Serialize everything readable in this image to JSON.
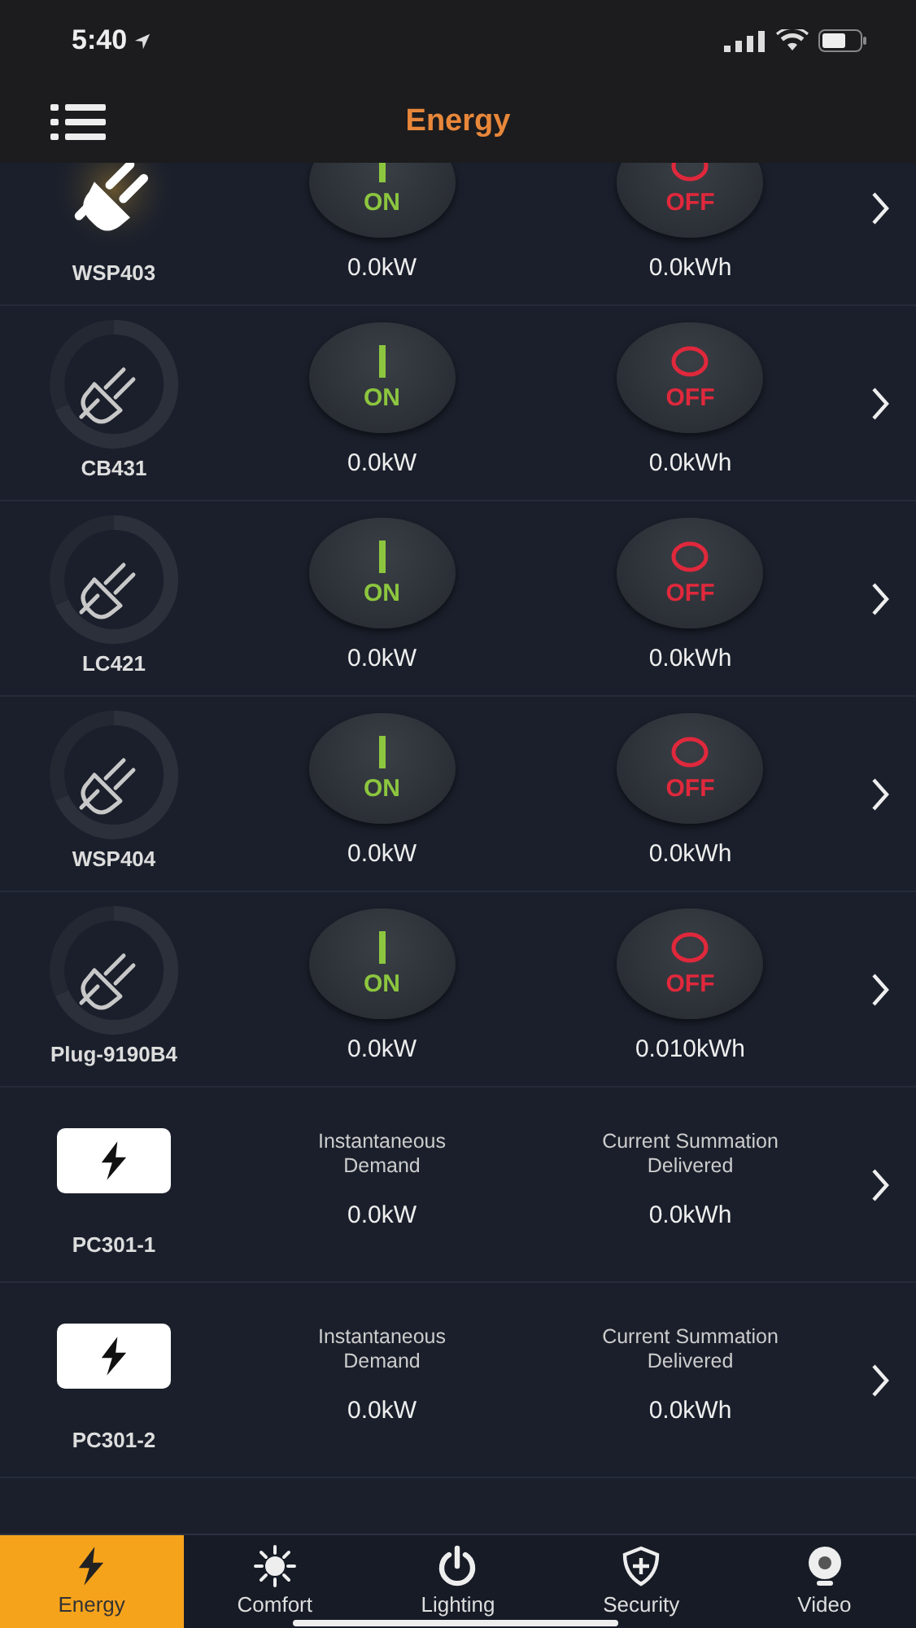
{
  "status_bar": {
    "time": "5:40"
  },
  "nav": {
    "title": "Energy"
  },
  "devices": [
    {
      "kind": "plug",
      "name": "WSP403",
      "on": true,
      "on_label": "ON",
      "off_label": "OFF",
      "power": "0.0kW",
      "energy": "0.0kWh"
    },
    {
      "kind": "plug",
      "name": "CB431",
      "on": false,
      "on_label": "ON",
      "off_label": "OFF",
      "power": "0.0kW",
      "energy": "0.0kWh"
    },
    {
      "kind": "plug",
      "name": "LC421",
      "on": false,
      "on_label": "ON",
      "off_label": "OFF",
      "power": "0.0kW",
      "energy": "0.0kWh"
    },
    {
      "kind": "plug",
      "name": "WSP404",
      "on": false,
      "on_label": "ON",
      "off_label": "OFF",
      "power": "0.0kW",
      "energy": "0.0kWh"
    },
    {
      "kind": "plug",
      "name": "Plug-9190B4",
      "on": false,
      "on_label": "ON",
      "off_label": "OFF",
      "power": "0.0kW",
      "energy": "0.010kWh"
    },
    {
      "kind": "meter",
      "name": "PC301-1",
      "demand_label": "Instantaneous Demand",
      "summation_label": "Current Summation Delivered",
      "power": "0.0kW",
      "energy": "0.0kWh"
    },
    {
      "kind": "meter",
      "name": "PC301-2",
      "demand_label": "Instantaneous Demand",
      "summation_label": "Current Summation Delivered",
      "power": "0.0kW",
      "energy": "0.0kWh"
    }
  ],
  "tabs": [
    {
      "kind": "energy",
      "label": "Energy",
      "selected": true
    },
    {
      "kind": "comfort",
      "label": "Comfort",
      "selected": false
    },
    {
      "kind": "lighting",
      "label": "Lighting",
      "selected": false
    },
    {
      "kind": "security",
      "label": "Security",
      "selected": false
    },
    {
      "kind": "video",
      "label": "Video",
      "selected": false
    }
  ]
}
